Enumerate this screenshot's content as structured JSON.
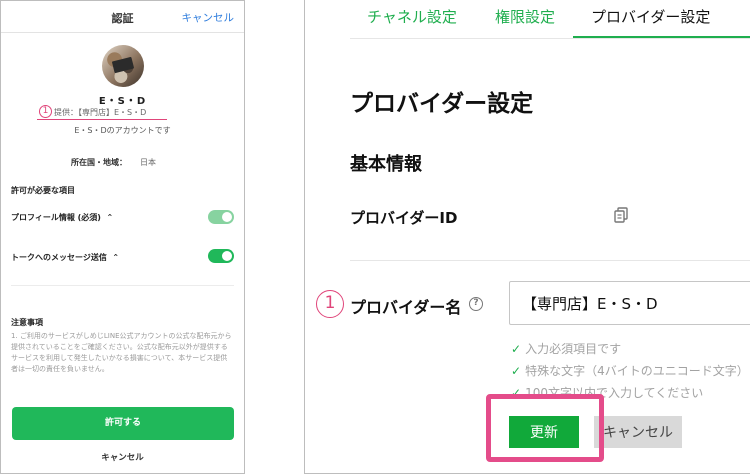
{
  "consent": {
    "title": "認証",
    "cancel_top": "キャンセル",
    "name": "E・S・D",
    "badge": "1",
    "provider_line": "提供：【専門店】E・S・D",
    "account_line": "E・S・Dのアカウントです",
    "country_label": "所在国・地域：",
    "country_value": "日本",
    "permissions_heading": "許可が必要な項目",
    "permissions": [
      {
        "label": "プロフィール情報 (必須)",
        "enabled": true
      },
      {
        "label": "トークへのメッセージ送信",
        "enabled": true
      }
    ],
    "notes_heading": "注意事項",
    "notes_body": "1. ご利用のサービスがしめじLINE公式アカウントの公式な配布元から提供されていることをご確認ください。公式な配布元以外が提供するサービスを利用して発生したいかなる損害について、本サービス提供者は一切の責任を負いません。",
    "allow_button": "許可する",
    "cancel_bottom": "キャンセル"
  },
  "provider": {
    "tabs": [
      {
        "label": "チャネル設定",
        "active": false
      },
      {
        "label": "権限設定",
        "active": false
      },
      {
        "label": "プロバイダー設定",
        "active": true
      }
    ],
    "title": "プロバイダー設定",
    "section": "基本情報",
    "id_label": "プロバイダーID",
    "badge": "1",
    "name_label": "プロバイダー名",
    "name_value": "【専門店】E・S・D",
    "rules": [
      "入力必須項目です",
      "特殊な文字（4バイトのユニコード文字）",
      "100文字以内で入力してください"
    ],
    "update_button": "更新",
    "cancel_button": "キャンセル"
  },
  "colors": {
    "line_green": "#1fae4e",
    "button_green": "#11a93a",
    "highlight_pink": "#e44c8a",
    "link_blue": "#2f7ddd"
  },
  "icons": [
    "copy-icon",
    "help-icon",
    "check-icon"
  ]
}
